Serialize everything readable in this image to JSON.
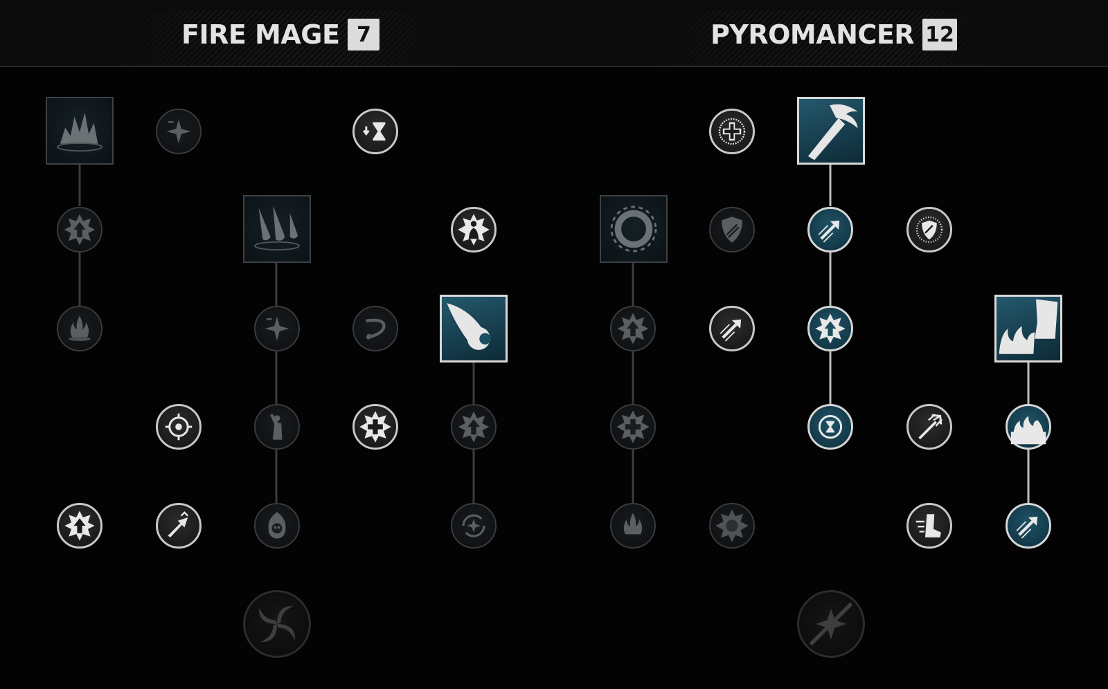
{
  "colors": {
    "background": "#030303",
    "header": "#0b0b0b",
    "title_text": "#e3e3e3",
    "badge_bg": "#dcdcdc",
    "connector": "#3c3c3c",
    "connector_active": "#bdbdbd",
    "active_fill": "#1f5266",
    "locked_border": "#3a3a3a"
  },
  "trees": [
    {
      "title": "FIRE MAGE",
      "level": "7"
    },
    {
      "title": "PYROMANCER",
      "level": "12"
    }
  ],
  "fire_mage_nodes": [
    {
      "name": "fire-explosion-skill",
      "icon": "explosion-icon",
      "state": "locked"
    },
    {
      "name": "sparkle-minus-passive",
      "icon": "sparkle-minus-icon",
      "state": "locked"
    },
    {
      "name": "cooldown-reduction-passive",
      "icon": "hourglass-down-icon",
      "state": "available"
    },
    {
      "name": "up-burst-passive-1",
      "icon": "up-arrow-burst-icon",
      "state": "locked"
    },
    {
      "name": "meteor-skill",
      "icon": "meteor-icon",
      "state": "locked"
    },
    {
      "name": "flame-aura-passive",
      "icon": "aura-figure-icon",
      "state": "available"
    },
    {
      "name": "burning-ground-passive",
      "icon": "flame-burst-icon",
      "state": "locked"
    },
    {
      "name": "sparkle-minus-passive-2",
      "icon": "sparkle-minus-icon",
      "state": "locked"
    },
    {
      "name": "ricochet-passive",
      "icon": "ricochet-icon",
      "state": "locked"
    },
    {
      "name": "fireball-skill",
      "icon": "fireball-icon",
      "state": "active"
    },
    {
      "name": "crosshair-passive",
      "icon": "crosshair-icon",
      "state": "available"
    },
    {
      "name": "empowered-figure-passive",
      "icon": "figure-raise-icon",
      "state": "locked"
    },
    {
      "name": "healing-burst-passive",
      "icon": "plus-burst-icon",
      "state": "available"
    },
    {
      "name": "up-burst-passive-2",
      "icon": "up-arrow-burst-icon",
      "state": "locked"
    },
    {
      "name": "up-burst-passive-3",
      "icon": "up-arrow-burst-icon",
      "state": "available"
    },
    {
      "name": "dash-passive",
      "icon": "dash-up-icon",
      "state": "available"
    },
    {
      "name": "skull-fire-passive",
      "icon": "skull-fire-icon",
      "state": "locked"
    },
    {
      "name": "refresh-passive",
      "icon": "refresh-icon",
      "state": "locked"
    },
    {
      "name": "fire-mage-ultimate",
      "icon": "vortex-icon",
      "state": "locked"
    }
  ],
  "pyromancer_nodes": [
    {
      "name": "healing-passive",
      "icon": "plus-circle-icon",
      "state": "available"
    },
    {
      "name": "flame-sword-skill",
      "icon": "flame-sword-icon",
      "state": "active"
    },
    {
      "name": "ring-of-fire-skill",
      "icon": "fire-ring-icon",
      "state": "locked"
    },
    {
      "name": "shield-passive",
      "icon": "shield-icon",
      "state": "locked"
    },
    {
      "name": "attack-speed-passive-1",
      "icon": "dash-arrow-icon",
      "state": "active"
    },
    {
      "name": "radiant-shield-passive",
      "icon": "radiant-shield-icon",
      "state": "available"
    },
    {
      "name": "up-burst-passive-p1",
      "icon": "up-arrow-burst-icon",
      "state": "locked"
    },
    {
      "name": "attack-speed-passive-2",
      "icon": "dash-arrow-icon",
      "state": "available"
    },
    {
      "name": "up-burst-passive-p2",
      "icon": "up-arrow-burst-icon",
      "state": "active"
    },
    {
      "name": "fire-stomp-skill",
      "icon": "fire-stomp-icon",
      "state": "active"
    },
    {
      "name": "heal-burst-passive-p",
      "icon": "plus-burst-icon",
      "state": "locked"
    },
    {
      "name": "cooldown-refresh-passive",
      "icon": "hourglass-circle-icon",
      "state": "active"
    },
    {
      "name": "trident-passive",
      "icon": "trident-icon",
      "state": "available"
    },
    {
      "name": "flames-passive",
      "icon": "flames-icon",
      "state": "active"
    },
    {
      "name": "fire-burst-passive",
      "icon": "flame-burst-icon",
      "state": "locked"
    },
    {
      "name": "spiked-burst-passive",
      "icon": "spike-burst-icon",
      "state": "locked"
    },
    {
      "name": "speed-boot-passive",
      "icon": "boot-icon",
      "state": "available"
    },
    {
      "name": "attack-speed-passive-3",
      "icon": "dash-arrow-icon",
      "state": "active"
    },
    {
      "name": "pyromancer-ultimate",
      "icon": "sparkle-slash-icon",
      "state": "locked"
    }
  ]
}
